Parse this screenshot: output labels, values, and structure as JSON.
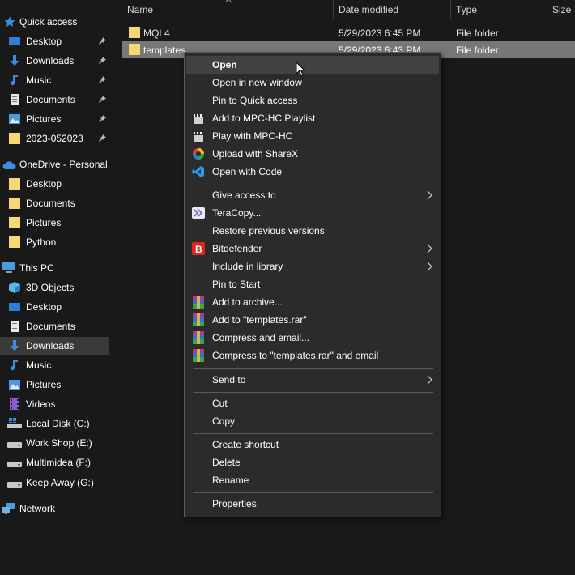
{
  "nav": {
    "quick_access": "Quick access",
    "qa_desktop": "Desktop",
    "qa_downloads": "Downloads",
    "qa_music": "Music",
    "qa_documents": "Documents",
    "qa_pictures": "Pictures",
    "qa_folder": "2023-052023",
    "onedrive": "OneDrive - Personal",
    "od_desktop": "Desktop",
    "od_documents": "Documents",
    "od_pictures": "Pictures",
    "od_python": "Python",
    "this_pc": "This PC",
    "pc_3d": "3D Objects",
    "pc_desktop": "Desktop",
    "pc_documents": "Documents",
    "pc_downloads": "Downloads",
    "pc_music": "Music",
    "pc_pictures": "Pictures",
    "pc_videos": "Videos",
    "pc_c": "Local Disk (C:)",
    "pc_e": "Work Shop (E:)",
    "pc_f": "Multimidea (F:)",
    "pc_g": "Keep Away (G:)",
    "network": "Network"
  },
  "columns": {
    "name": "Name",
    "date": "Date modified",
    "type": "Type",
    "size": "Size"
  },
  "files": [
    {
      "name": "MQL4",
      "date": "5/29/2023 6:45 PM",
      "type": "File folder"
    },
    {
      "name": "templates",
      "date": "5/29/2023 6:43 PM",
      "type": "File folder"
    }
  ],
  "menu": {
    "open": "Open",
    "open_new_window": "Open in new window",
    "pin_quick": "Pin to Quick access",
    "mpc_playlist": "Add to MPC-HC Playlist",
    "mpc_play": "Play with MPC-HC",
    "sharex": "Upload with ShareX",
    "vscode": "Open with Code",
    "give_access": "Give access to",
    "teracopy": "TeraCopy...",
    "restore": "Restore previous versions",
    "bitdefender": "Bitdefender",
    "library": "Include in library",
    "pin_start": "Pin to Start",
    "add_archive": "Add to archive...",
    "add_rar": "Add to \"templates.rar\"",
    "compress_email": "Compress and email...",
    "compress_rar_email": "Compress to \"templates.rar\" and email",
    "send_to": "Send to",
    "cut": "Cut",
    "copy": "Copy",
    "shortcut": "Create shortcut",
    "delete": "Delete",
    "rename": "Rename",
    "properties": "Properties"
  },
  "colors": {
    "folder": "#f8d775",
    "accent_blue": "#3a8ee6",
    "bitdefender": "#e2231a"
  }
}
